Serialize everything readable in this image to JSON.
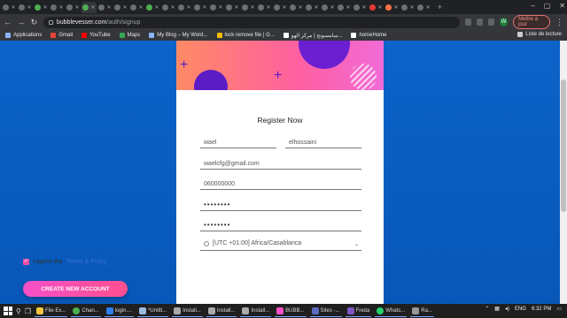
{
  "browser": {
    "url_host": "bubblevesser.com",
    "url_path": "/auth/signup",
    "update_button": "Mettre à jour",
    "avatar_letter": "W"
  },
  "bookmarks": {
    "items": [
      "Applications",
      "Gmail",
      "YouTube",
      "Maps",
      "My Blog – My Word...",
      "lock remove file | G...",
      "سامسونج | مركز الهو...",
      "homeHome"
    ],
    "reading_list": "Liste de lecture"
  },
  "form": {
    "title": "Register Now",
    "first_name": "wael",
    "last_name": "elhossaini",
    "email": "waelcfg@gmail.com",
    "phone": "060000000",
    "password": "••••••••",
    "password_confirm": "••••••••",
    "timezone": "[UTC +01:00] Africa/Casablanca",
    "agree_prefix": "I agree the",
    "agree_link": "Terms & Policy",
    "submit_label": "CREATE NEW ACCOUNT"
  },
  "taskbar": {
    "apps": [
      "File Ex...",
      "Chan...",
      "login....",
      "*Untitl...",
      "Install...",
      "Install...",
      "Install...",
      "BUBB...",
      "Sites -...",
      "Freda",
      "Whats...",
      "Ra..."
    ],
    "language": "ENG",
    "time": "6:32 PM"
  },
  "colors": {
    "page_bg": "#0c63c9",
    "accent_pink": "#f650c8",
    "hero_purple": "#6a1fd1",
    "link": "#3d6fd8"
  }
}
